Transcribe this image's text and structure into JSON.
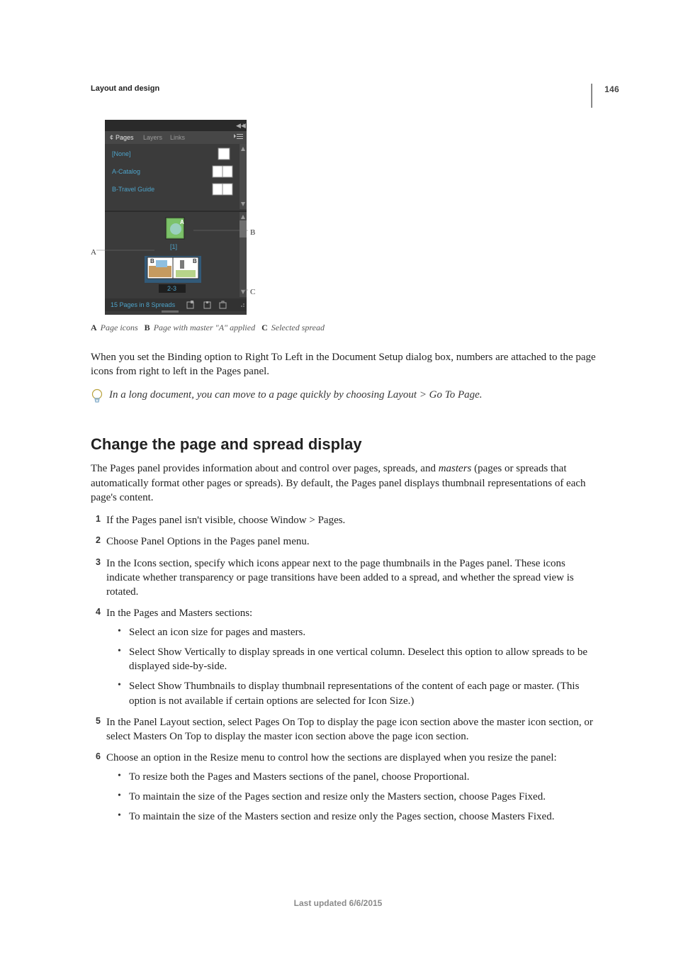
{
  "pageNumber": "146",
  "sectionLabel": "Layout and design",
  "panel": {
    "tabs": {
      "pages": "Pages",
      "layers": "Layers",
      "links": "Links"
    },
    "masters": {
      "none": "[None]",
      "a": "A-Catalog",
      "b": "B-Travel Guide"
    },
    "spreadLabels": {
      "s1": "[1]",
      "s2": "2-3"
    },
    "tileLetters": {
      "A": "A",
      "B": "B"
    },
    "panelDot": "¢",
    "status": "15 Pages in 8 Spreads"
  },
  "callouts": {
    "A": "A",
    "B": "B",
    "C": "C"
  },
  "caption": {
    "A_label": "A",
    "A_text": "Page icons",
    "B_label": "B",
    "B_text": "Page with master \"A\" applied",
    "C_label": "C",
    "C_text": "Selected spread"
  },
  "paragraphs": {
    "binding": "When you set the Binding option to Right To Left in the Document Setup dialog box, numbers are attached to the page icons from right to left in the Pages panel."
  },
  "tip": {
    "text": "In a long document, you can move to a page quickly by choosing Layout > Go To Page."
  },
  "heading": "Change the page and spread display",
  "intro": {
    "pre": "The Pages panel provides information about and control over pages, spreads, and ",
    "em": "masters",
    "post": " (pages or spreads that automatically format other pages or spreads). By default, the Pages panel displays thumbnail representations of each page's content."
  },
  "steps": {
    "s1": "If the Pages panel isn't visible, choose Window > Pages.",
    "s2": "Choose Panel Options in the Pages panel menu.",
    "s3": "In the Icons section, specify which icons appear next to the page thumbnails in the Pages panel. These icons indicate whether transparency or page transitions have been added to a spread, and whether the spread view is rotated.",
    "s4": "In the Pages and Masters sections:",
    "s4a": "Select an icon size for pages and masters.",
    "s4b": "Select Show Vertically to display spreads in one vertical column. Deselect this option to allow spreads to be displayed side-by-side.",
    "s4c": "Select Show Thumbnails to display thumbnail representations of the content of each page or master. (This option is not available if certain options are selected for Icon Size.)",
    "s5": "In the Panel Layout section, select Pages On Top to display the page icon section above the master icon section, or select Masters On Top to display the master icon section above the page icon section.",
    "s6": "Choose an option in the Resize menu to control how the sections are displayed when you resize the panel:",
    "s6a": "To resize both the Pages and Masters sections of the panel, choose Proportional.",
    "s6b": "To maintain the size of the Pages section and resize only the Masters section, choose Pages Fixed.",
    "s6c": "To maintain the size of the Masters section and resize only the Pages section, choose Masters Fixed."
  },
  "footer": "Last updated 6/6/2015"
}
